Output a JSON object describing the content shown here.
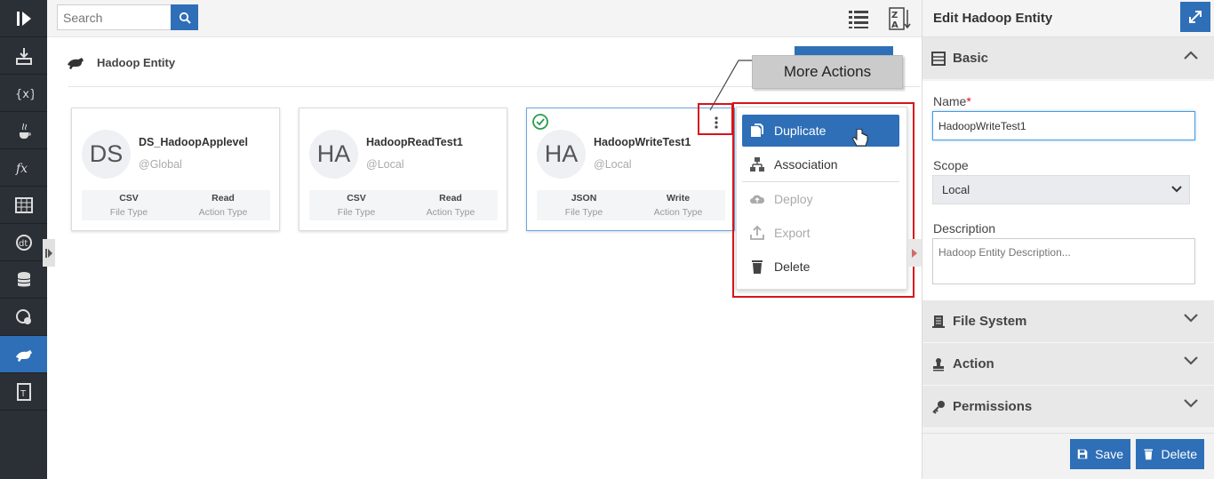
{
  "search": {
    "placeholder": "Search"
  },
  "page": {
    "title": "Hadoop Entity"
  },
  "cards": [
    {
      "initials": "DS",
      "name": "DS_HadoopApplevel",
      "scope": "@Global",
      "file_type": "CSV",
      "file_type_label": "File Type",
      "action_type": "Read",
      "action_type_label": "Action Type"
    },
    {
      "initials": "HA",
      "name": "HadoopReadTest1",
      "scope": "@Local",
      "file_type": "CSV",
      "file_type_label": "File Type",
      "action_type": "Read",
      "action_type_label": "Action Type"
    },
    {
      "initials": "HA",
      "name": "HadoopWriteTest1",
      "scope": "@Local",
      "file_type": "JSON",
      "file_type_label": "File Type",
      "action_type": "Write",
      "action_type_label": "Action Type"
    }
  ],
  "callout": {
    "text": "More Actions"
  },
  "menu": {
    "items": [
      {
        "label": "Duplicate",
        "icon": "duplicate-icon"
      },
      {
        "label": "Association",
        "icon": "association-icon"
      },
      {
        "label": "Deploy",
        "icon": "cloud-upload-icon"
      },
      {
        "label": "Export",
        "icon": "export-icon"
      },
      {
        "label": "Delete",
        "icon": "trash-icon"
      }
    ]
  },
  "panel": {
    "title": "Edit Hadoop Entity",
    "sections": {
      "basic": "Basic",
      "file_system": "File System",
      "action": "Action",
      "permissions": "Permissions"
    },
    "fields": {
      "name_label": "Name",
      "name_value": "HadoopWriteTest1",
      "scope_label": "Scope",
      "scope_value": "Local",
      "description_label": "Description",
      "description_placeholder": "Hadoop Entity Description..."
    },
    "save_label": "Save",
    "delete_label": "Delete"
  },
  "colors": {
    "accent": "#2e6fb7",
    "rail": "#2b2f36",
    "highlight": "#d9131a"
  }
}
